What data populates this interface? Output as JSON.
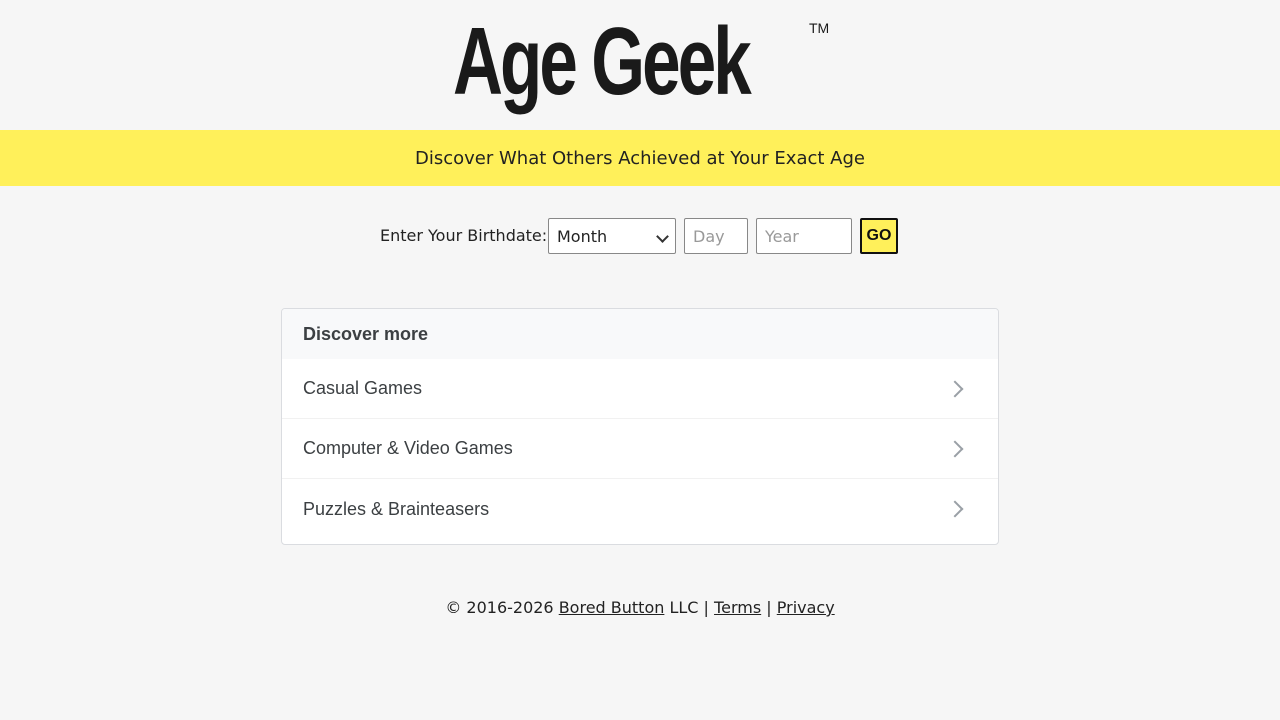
{
  "logo": {
    "text": "Age Geek",
    "trademark": "TM"
  },
  "banner": {
    "text": "Discover What Others Achieved at Your Exact Age"
  },
  "form": {
    "label": "Enter Your Birthdate:",
    "month_value": "Month",
    "day_placeholder": "Day",
    "year_placeholder": "Year",
    "go_label": "GO"
  },
  "discover": {
    "title": "Discover more",
    "items": [
      {
        "label": "Casual Games"
      },
      {
        "label": "Computer & Video Games"
      },
      {
        "label": "Puzzles & Brainteasers"
      }
    ]
  },
  "footer": {
    "copyright": "© 2016-2026",
    "company_link": "Bored Button",
    "company_suffix": "LLC |",
    "terms_link": "Terms",
    "separator": "|",
    "privacy_link": "Privacy"
  },
  "colors": {
    "accent_yellow": "#fff05a",
    "background": "#f6f6f6",
    "text": "#222222"
  }
}
